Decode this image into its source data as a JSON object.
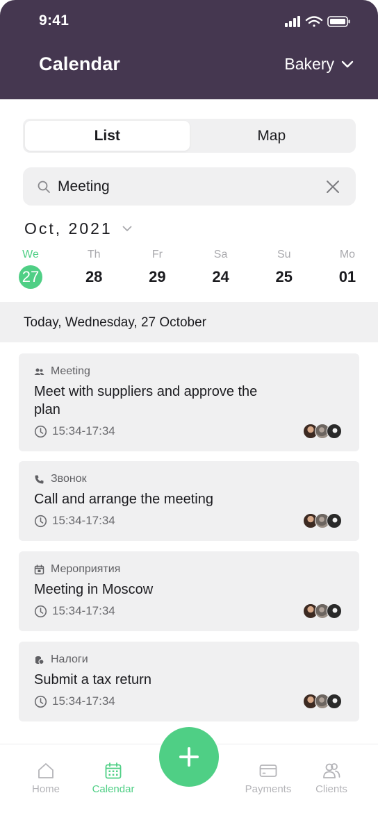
{
  "status_bar": {
    "time": "9:41"
  },
  "header": {
    "title": "Calendar",
    "business": "Bakery"
  },
  "segments": [
    {
      "label": "List",
      "active": true
    },
    {
      "label": "Map",
      "active": false
    }
  ],
  "search": {
    "value": "Meeting"
  },
  "month": {
    "label": "Oct, 2021"
  },
  "days": [
    {
      "weekday": "We",
      "date": "27",
      "selected": true
    },
    {
      "weekday": "Th",
      "date": "28",
      "selected": false
    },
    {
      "weekday": "Fr",
      "date": "29",
      "selected": false
    },
    {
      "weekday": "Sa",
      "date": "24",
      "selected": false
    },
    {
      "weekday": "Su",
      "date": "25",
      "selected": false
    },
    {
      "weekday": "Mo",
      "date": "01",
      "selected": false
    }
  ],
  "today_label": "Today, Wednesday, 27 October",
  "events": [
    {
      "category": "Meeting",
      "icon": "people-icon",
      "title": "Meet with suppliers and approve the plan",
      "time": "15:34-17:34"
    },
    {
      "category": "Звонок",
      "icon": "phone-icon",
      "title": "Call and arrange the meeting",
      "time": "15:34-17:34"
    },
    {
      "category": "Мероприятия",
      "icon": "calendar-event-icon",
      "title": "Meeting in Moscow",
      "time": "15:34-17:34"
    },
    {
      "category": "Налоги",
      "icon": "coins-icon",
      "title": "Submit a tax return",
      "time": "15:34-17:34"
    }
  ],
  "nav": {
    "home": "Home",
    "calendar": "Calendar",
    "payments": "Payments",
    "clients": "Clients"
  },
  "colors": {
    "header_bg": "#453750",
    "accent": "#4fcf85",
    "surface": "#f0f0f1"
  }
}
